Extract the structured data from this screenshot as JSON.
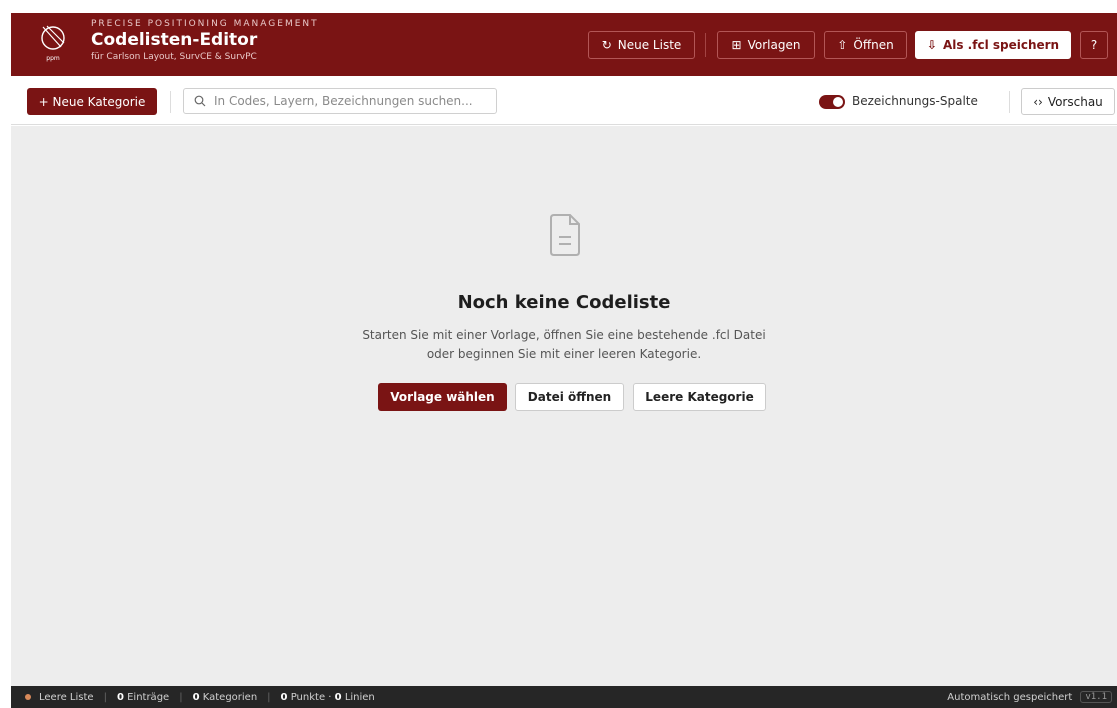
{
  "header": {
    "org": "PRECISE POSITIONING MANAGEMENT",
    "title": "Codelisten-Editor",
    "subtitle": "für Carlson Layout, SurvCE & SurvPC",
    "logo_text": "ppm",
    "buttons": {
      "new_list": "Neue Liste",
      "templates": "Vorlagen",
      "open": "Öffnen",
      "save": "Als .fcl speichern"
    },
    "help_icon": "help-icon"
  },
  "toolbar": {
    "new_category": "+ Neue Kategorie",
    "search_placeholder": "In Codes, Layern, Bezeichnungen suchen...",
    "toggle_label": "Bezeichnungs-Spalte",
    "toggle_on": true,
    "preview": "Vorschau"
  },
  "empty_state": {
    "title": "Noch keine Codeliste",
    "desc_line1": "Starten Sie mit einer Vorlage, öffnen Sie eine bestehende .fcl Datei",
    "desc_line2": "oder beginnen Sie mit einer leeren Kategorie.",
    "btn_template": "Vorlage wählen",
    "btn_open": "Datei öffnen",
    "btn_empty": "Leere Kategorie"
  },
  "status": {
    "list_state": "Leere Liste",
    "entries_count": "0",
    "entries_label": "Einträge",
    "categories_count": "0",
    "categories_label": "Kategorien",
    "points_count": "0",
    "points_label": "Punkte ·",
    "lines_count": "0",
    "lines_label": "Linien",
    "autosave": "Automatisch gespeichert",
    "version": "v1.1"
  },
  "colors": {
    "brand": "#7a1414",
    "main_bg": "#ededed",
    "status_bg": "#262626",
    "status_dot": "#d98a5a"
  }
}
